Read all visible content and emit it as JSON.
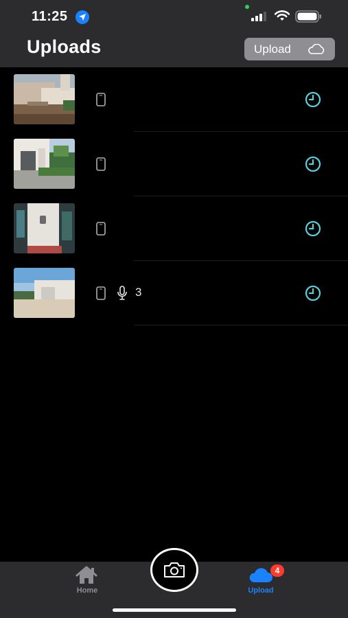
{
  "status_bar": {
    "time": "11:25",
    "icons": [
      "location-arrow-icon",
      "signal-icon",
      "wifi-icon",
      "battery-icon"
    ]
  },
  "header": {
    "title": "Uploads",
    "upload_button_label": "Upload"
  },
  "uploads": [
    {
      "thumbnail": "house-exterior-wall-photo",
      "device_icon": "phone-icon",
      "status_icon": "clock-icon"
    },
    {
      "thumbnail": "house-front-entrance-photo",
      "device_icon": "phone-icon",
      "status_icon": "clock-icon"
    },
    {
      "thumbnail": "wall-light-fixture-photo",
      "device_icon": "phone-icon",
      "status_icon": "clock-icon"
    },
    {
      "thumbnail": "driveway-garage-photo",
      "device_icon": "phone-icon",
      "status_icon": "clock-icon",
      "audio_icon": "microphone-icon",
      "audio_count": "3"
    }
  ],
  "tab_bar": {
    "home_label": "Home",
    "upload_label": "Upload",
    "upload_badge": "4",
    "center_action": "camera-icon"
  },
  "colors": {
    "header_bg": "#2c2c2e",
    "accent_blue": "#1a82ff",
    "clock_teal": "#5ad0dc",
    "badge_red": "#ff3b30",
    "background": "#000000"
  }
}
